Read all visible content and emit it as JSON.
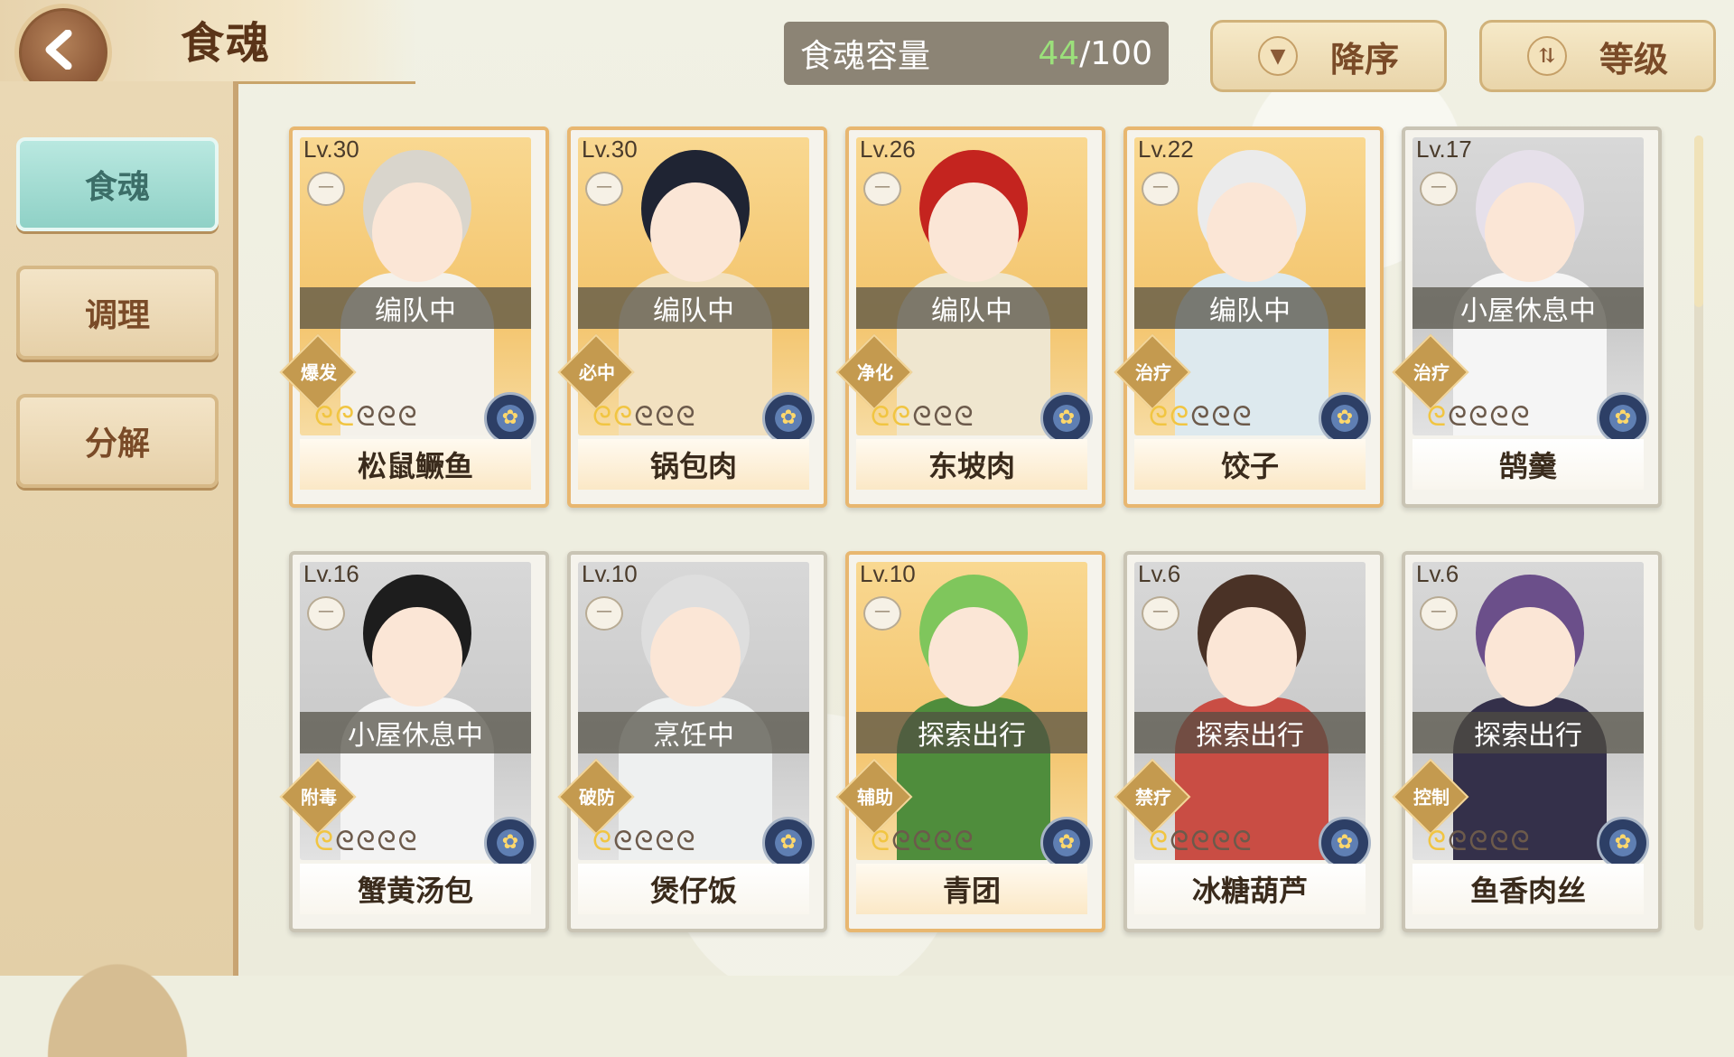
{
  "header": {
    "title": "食魂",
    "back_label": ""
  },
  "sidebar": {
    "items": [
      {
        "label": "食魂",
        "active": true
      },
      {
        "label": "调理",
        "active": false
      },
      {
        "label": "分解",
        "active": false
      }
    ]
  },
  "capacity": {
    "label": "食魂容量",
    "current": "44",
    "separator": "/",
    "max": "100"
  },
  "sort": {
    "order_label": "降序",
    "key_label": "等级"
  },
  "cards": [
    {
      "level": "Lv.30",
      "status": "编队中",
      "type": "爆发",
      "name": "松鼠鳜鱼",
      "stars_on": 2,
      "tier": "gold",
      "hair": "#d9d5cc",
      "cloth": "#f4f1ea"
    },
    {
      "level": "Lv.30",
      "status": "编队中",
      "type": "必中",
      "name": "锅包肉",
      "stars_on": 2,
      "tier": "gold",
      "hair": "#1f2433",
      "cloth": "#f2e1c0"
    },
    {
      "level": "Lv.26",
      "status": "编队中",
      "type": "净化",
      "name": "东坡肉",
      "stars_on": 2,
      "tier": "gold",
      "hair": "#c4241f",
      "cloth": "#efe6cf"
    },
    {
      "level": "Lv.22",
      "status": "编队中",
      "type": "治疗",
      "name": "饺子",
      "stars_on": 2,
      "tier": "gold",
      "hair": "#ebebeb",
      "cloth": "#dde9ee"
    },
    {
      "level": "Lv.17",
      "status": "小屋休息中",
      "type": "治疗",
      "name": "鹄羹",
      "stars_on": 1,
      "tier": "silver",
      "hair": "#e6e0ea",
      "cloth": "#f5f5f5"
    },
    {
      "level": "Lv.16",
      "status": "小屋休息中",
      "type": "附毒",
      "name": "蟹黄汤包",
      "stars_on": 1,
      "tier": "silver",
      "hair": "#1d1d1d",
      "cloth": "#f3f3f3"
    },
    {
      "level": "Lv.10",
      "status": "烹饪中",
      "type": "破防",
      "name": "煲仔饭",
      "stars_on": 1,
      "tier": "silver",
      "hair": "#dedede",
      "cloth": "#eef0f0"
    },
    {
      "level": "Lv.10",
      "status": "探索出行",
      "type": "辅助",
      "name": "青团",
      "stars_on": 1,
      "tier": "gold",
      "hair": "#7fc65c",
      "cloth": "#4f8d3c"
    },
    {
      "level": "Lv.6",
      "status": "探索出行",
      "type": "禁疗",
      "name": "冰糖葫芦",
      "stars_on": 1,
      "tier": "silver",
      "hair": "#4a3226",
      "cloth": "#c94d44"
    },
    {
      "level": "Lv.6",
      "status": "探索出行",
      "type": "控制",
      "name": "鱼香肉丝",
      "stars_on": 1,
      "tier": "silver",
      "hair": "#6b4f8a",
      "cloth": "#34304a"
    }
  ],
  "icons": {
    "back": "chevron-left-icon",
    "sort_order": "triangle-down-icon",
    "sort_key": "sort-arrows-icon",
    "bowl": "bowl-icon",
    "element": "flower-emblem-icon"
  },
  "colors": {
    "accent": "#c49a4f",
    "capacity_current": "#9be07b",
    "active_tab": "#8fd1c6"
  }
}
